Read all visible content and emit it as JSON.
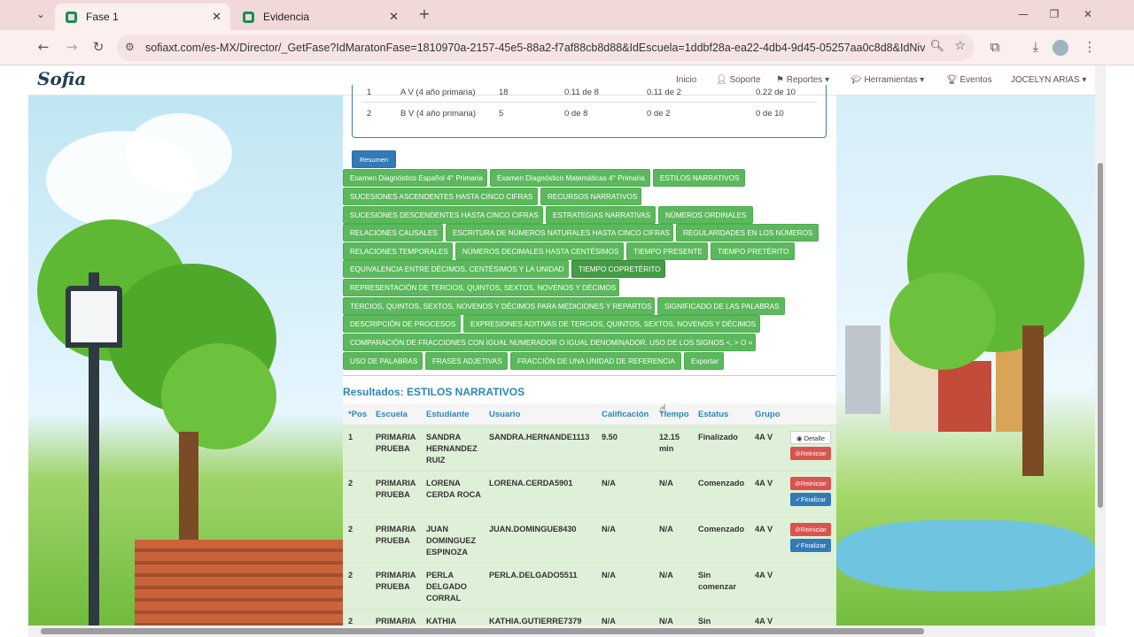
{
  "browser": {
    "tabs": [
      {
        "label": "Fase 1",
        "active": true
      },
      {
        "label": "Evidencia",
        "active": false
      }
    ],
    "new_tab": "+",
    "url": "sofiaxt.com/es-MX/Director/_GetFase?IdMaratonFase=1810970a-2157-45e5-88a2-f7af88cb8d88&IdEscuela=1ddbf28a-ea22-4db4-9d45-05257aa0c8d8&IdNivelEscol...",
    "window_controls": [
      "—",
      "❐",
      "✕"
    ]
  },
  "navbar": {
    "logo": "Sofia",
    "items": [
      "Inicio",
      "Soporte",
      "Reportes ▾",
      "Herramientas ▾",
      "Eventos",
      "JOCELYN ARIAS ▾"
    ]
  },
  "summary_rows": [
    {
      "n": "1",
      "grupo": "A V (4 año primaria)",
      "c1": "18",
      "c2": "0.11 de 8",
      "c3": "0.11 de 2",
      "c4": "0.22 de 10"
    },
    {
      "n": "2",
      "grupo": "B V (4 año primaria)",
      "c1": "5",
      "c2": "0 de 8",
      "c3": "0 de 2",
      "c4": "0 de 10"
    }
  ],
  "resumen_label": "Resumen",
  "topics": [
    "Examen Diagnóstico Español 4° Primaria",
    "Examen Diagnóstico Matemáticas 4° Primaria",
    "ESTILOS NARRATIVOS",
    "SUCESIONES ASCENDENTES HASTA CINCO CIFRAS",
    "RECURSOS NARRATIVOS",
    "SUCESIONES DESCENDENTES HASTA CINCO CIFRAS",
    "ESTRATEGIAS NARRATIVAS",
    "NÚMEROS ORDINALES",
    "RELACIONES CAUSALES",
    "ESCRITURA DE NÚMEROS NATURALES HASTA CINCO CIFRAS",
    "REGULARIDADES EN LOS NÚMEROS",
    "RELACIONES TEMPORALES",
    "NÚMEROS DECIMALES HASTA CENTÉSIMOS",
    "TIEMPO PRESENTE",
    "TIEMPO PRETÉRITO",
    "EQUIVALENCIA ENTRE DÉCIMOS, CENTÉSIMOS Y LA UNIDAD",
    "TIEMPO COPRETÉRITO",
    "REPRESENTACIÓN DE TERCIOS, QUINTOS, SEXTOS, NOVENOS Y DÉCIMOS",
    "TERCIOS, QUINTOS, SEXTOS, NOVENOS Y DÉCIMOS PARA MEDICIONES Y REPARTOS",
    "SIGNIFICADO DE LAS PALABRAS",
    "DESCRIPCIÓN DE PROCESOS",
    "EXPRESIONES ADITIVAS DE TERCIOS, QUINTOS, SEXTOS, NOVENOS Y DÉCIMOS",
    "COMPARACIÓN DE FRACCIONES CON IGUAL NUMERADOR O IGUAL DENOMINADOR. USO DE LOS SIGNOS <, > O =",
    "USO DE PALABRAS",
    "FRASES ADJETIVAS",
    "FRACCIÓN DE UNA UNIDAD DE REFERENCIA",
    "Exportar"
  ],
  "results": {
    "title": "Resultados: ESTILOS NARRATIVOS",
    "headers": [
      "*Pos",
      "Escuela",
      "Estudiante",
      "Usuario",
      "Calificación",
      "Tiempo",
      "Estatus",
      "Grupo"
    ],
    "rows": [
      {
        "pos": "1",
        "escuela": "PRIMARIA PRUEBA",
        "estudiante": "SANDRA HERNANDEZ RUIZ",
        "usuario": "SANDRA.HERNANDE1113",
        "calif": "9.50",
        "tiempo": "12.15 min",
        "estatus": "Finalizado",
        "grupo": "4A V",
        "actions": [
          "Detalle",
          "Reiniciar"
        ]
      },
      {
        "pos": "2",
        "escuela": "PRIMARIA PRUEBA",
        "estudiante": "LORENA CERDA ROCA",
        "usuario": "LORENA.CERDA5901",
        "calif": "N/A",
        "tiempo": "N/A",
        "estatus": "Comenzado",
        "grupo": "4A V",
        "actions": [
          "Reiniciar",
          "Finalizar"
        ]
      },
      {
        "pos": "2",
        "escuela": "PRIMARIA PRUEBA",
        "estudiante": "JUAN DOMINGUEZ ESPINOZA",
        "usuario": "JUAN.DOMINGUE8430",
        "calif": "N/A",
        "tiempo": "N/A",
        "estatus": "Comenzado",
        "grupo": "4A V",
        "actions": [
          "Reiniciar",
          "Finalizar"
        ]
      },
      {
        "pos": "2",
        "escuela": "PRIMARIA PRUEBA",
        "estudiante": "PERLA DELGADO CORRAL",
        "usuario": "PERLA.DELGADO5511",
        "calif": "N/A",
        "tiempo": "N/A",
        "estatus": "Sin comenzar",
        "grupo": "4A V",
        "actions": []
      },
      {
        "pos": "2",
        "escuela": "PRIMARIA",
        "estudiante": "KATHIA",
        "usuario": "KATHIA.GUTIERRE7379",
        "calif": "N/A",
        "tiempo": "N/A",
        "estatus": "Sin",
        "grupo": "4A V",
        "actions": []
      }
    ]
  },
  "colors": {
    "green": "#5cb85c",
    "blue": "#337ab7",
    "red": "#d9534f",
    "title_blue": "#2c86b8"
  }
}
